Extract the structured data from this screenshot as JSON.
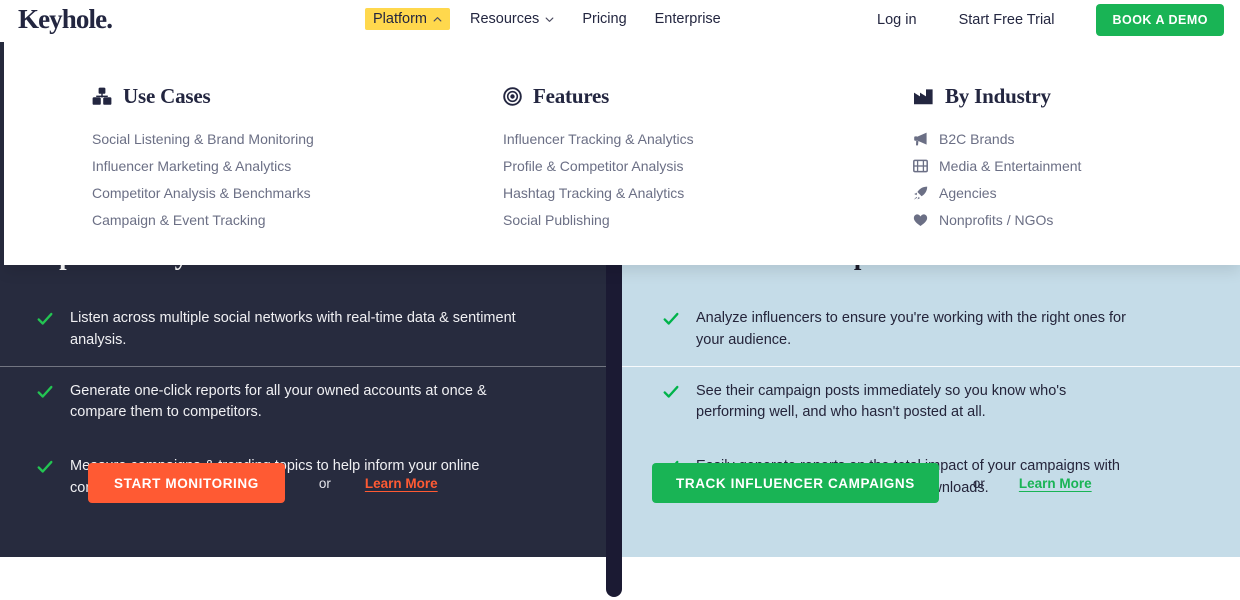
{
  "brand": {
    "logo_text": "Keyhole",
    "logo_suffix": ".",
    "accent_green": "#19B455",
    "accent_orange": "#FF5A33",
    "accent_yellow": "#FFD84D",
    "dark_navy": "#272B3E",
    "light_blue": "#C5DCE8"
  },
  "header": {
    "nav": [
      {
        "label": "Platform",
        "icon": "chevron-up-icon",
        "active": true
      },
      {
        "label": "Resources",
        "icon": "chevron-down-icon",
        "active": false
      },
      {
        "label": "Pricing",
        "icon": "",
        "active": false
      },
      {
        "label": "Enterprise",
        "icon": "",
        "active": false
      }
    ],
    "login_label": "Log in",
    "trial_label": "Start Free Trial",
    "demo_label": "BOOK A DEMO"
  },
  "mega_menu": {
    "columns": [
      {
        "title": "Use Cases",
        "icon": "cubes-icon",
        "links": [
          {
            "label": "Social Listening & Brand Monitoring",
            "icon": ""
          },
          {
            "label": "Influencer Marketing & Analytics",
            "icon": ""
          },
          {
            "label": "Competitor Analysis & Benchmarks",
            "icon": ""
          },
          {
            "label": "Campaign & Event Tracking",
            "icon": ""
          }
        ]
      },
      {
        "title": "Features",
        "icon": "target-icon",
        "links": [
          {
            "label": "Influencer Tracking & Analytics",
            "icon": ""
          },
          {
            "label": "Profile & Competitor Analysis",
            "icon": ""
          },
          {
            "label": "Hashtag Tracking & Analytics",
            "icon": ""
          },
          {
            "label": "Social Publishing",
            "icon": ""
          }
        ]
      },
      {
        "title": "By Industry",
        "icon": "factory-icon",
        "links": [
          {
            "label": "B2C Brands",
            "icon": "megaphone-icon"
          },
          {
            "label": "Media & Entertainment",
            "icon": "film-icon"
          },
          {
            "label": "Agencies",
            "icon": "rocket-icon"
          },
          {
            "label": "Nonprofits / NGOs",
            "icon": "heart-icon"
          }
        ]
      }
    ]
  },
  "cards": {
    "left": {
      "heading": "reports easily!",
      "bullets": [
        "Listen across multiple social networks with real-time data & sentiment analysis.",
        "Generate one-click reports for all your owned accounts at once & compare them to competitors.",
        "Measure campaigns & trending topics to help inform your online content strategy."
      ],
      "cta_label": "START MONITORING",
      "or_label": "or",
      "learn_label": "Learn More"
    },
    "right": {
      "heading": "screenshots. No spreadsheets.",
      "bullets": [
        "Analyze influencers to ensure you're working with the right ones for your audience.",
        "See their campaign posts immediately so you know who's performing well, and who hasn't posted at all.",
        "Easily generate reports on the total impact of your campaigns with a sharable dashboard & one-click downloads."
      ],
      "cta_label": "TRACK INFLUENCER CAMPAIGNS",
      "or_label": "or",
      "learn_label": "Learn More"
    }
  }
}
